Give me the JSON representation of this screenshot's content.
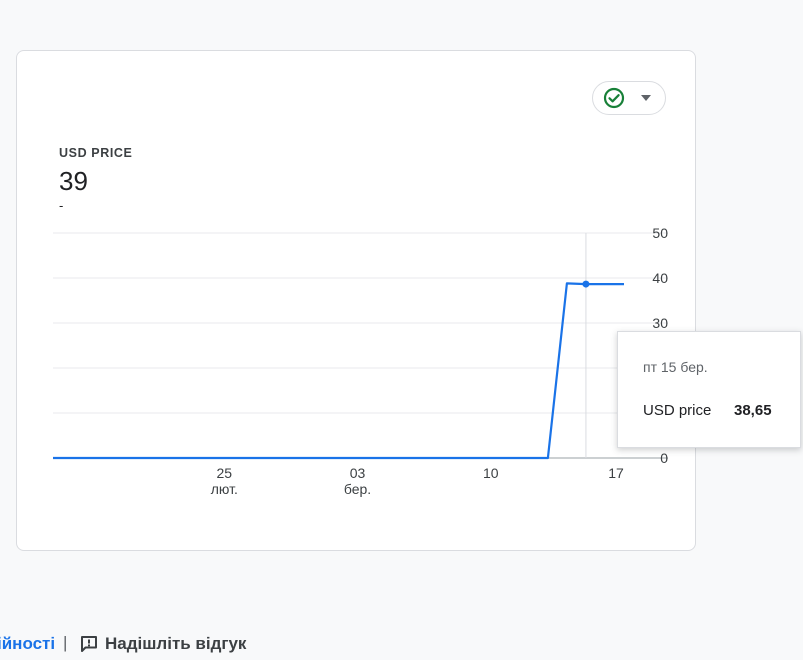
{
  "card": {
    "metric_label": "USD PRICE",
    "metric_value": "39",
    "metric_sub": "-",
    "status_icon": "check-circle-icon",
    "status_dropdown_icon": "caret-down-icon"
  },
  "tooltip": {
    "date": "пт 15 бер.",
    "series_label": "USD price",
    "value": "38,65"
  },
  "footer": {
    "partial_link": "ійності",
    "separator": "|",
    "feedback_icon": "feedback-icon",
    "feedback_label": "Надішліть відгук"
  },
  "colors": {
    "line": "#1a73e8",
    "status_ok": "#188038",
    "link": "#1a73e8"
  },
  "chart_data": {
    "type": "line",
    "y_ticks": [
      "50",
      "40",
      "30",
      "20",
      "10",
      "0"
    ],
    "ylim": [
      0,
      50
    ],
    "x_ticks": [
      {
        "day": "25",
        "month": "лют."
      },
      {
        "day": "03",
        "month": "бер."
      },
      {
        "day": "10",
        "month": ""
      },
      {
        "day": "17",
        "month": ""
      }
    ],
    "series": [
      {
        "name": "USD price",
        "x": [
          "2024-02-16",
          "2024-02-17",
          "2024-02-18",
          "2024-02-19",
          "2024-02-20",
          "2024-02-21",
          "2024-02-22",
          "2024-02-23",
          "2024-02-24",
          "2024-02-25",
          "2024-02-26",
          "2024-02-27",
          "2024-02-28",
          "2024-02-29",
          "2024-03-01",
          "2024-03-02",
          "2024-03-03",
          "2024-03-04",
          "2024-03-05",
          "2024-03-06",
          "2024-03-07",
          "2024-03-08",
          "2024-03-09",
          "2024-03-10",
          "2024-03-11",
          "2024-03-12",
          "2024-03-13",
          "2024-03-14",
          "2024-03-15",
          "2024-03-16",
          "2024-03-17"
        ],
        "y": [
          0,
          0,
          0,
          0,
          0,
          0,
          0,
          0,
          0,
          0,
          0,
          0,
          0,
          0,
          0,
          0,
          0,
          0,
          0,
          0,
          0,
          0,
          0,
          0,
          0,
          0,
          0,
          38.8,
          38.65,
          38.65,
          38.65
        ]
      }
    ],
    "highlight": {
      "x": "2024-03-15",
      "y": 38.65
    },
    "grid": true,
    "legend": "none"
  }
}
